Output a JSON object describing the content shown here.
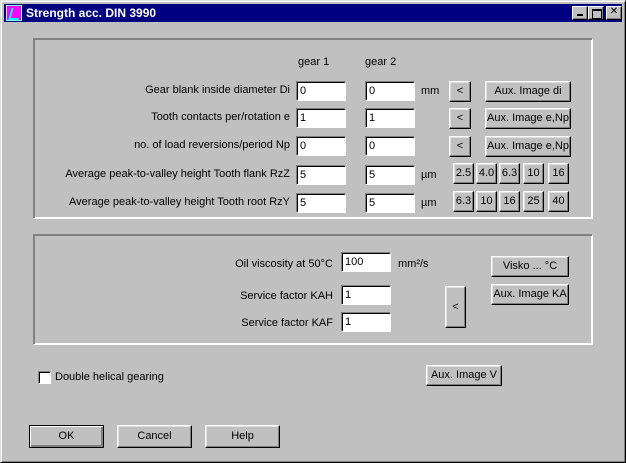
{
  "window": {
    "title": "Strength acc. DIN 3990"
  },
  "gear_table": {
    "col_gear1": "gear 1",
    "col_gear2": "gear 2",
    "rows": [
      {
        "label": "Gear blank inside diameter Di",
        "gear1": "0",
        "gear2": "0",
        "unit": "mm",
        "aux": "Aux. Image di"
      },
      {
        "label": "Tooth contacts per/rotation e",
        "gear1": "1",
        "gear2": "1",
        "unit": "",
        "aux": "Aux. Image e,Np"
      },
      {
        "label": "no. of load reversions/period Np",
        "gear1": "0",
        "gear2": "0",
        "unit": "",
        "aux": "Aux. Image e,Np"
      },
      {
        "label": "Average peak-to-valley height Tooth flank RzZ",
        "gear1": "5",
        "gear2": "5",
        "unit": "µm",
        "presets": [
          "2.5",
          "4.0",
          "6.3",
          "10",
          "16"
        ]
      },
      {
        "label": "Average peak-to-valley height Tooth root RzY",
        "gear1": "5",
        "gear2": "5",
        "unit": "µm",
        "presets": [
          "6.3",
          "10",
          "16",
          "25",
          "40"
        ]
      }
    ],
    "arrow": "<"
  },
  "oil_group": {
    "viscosity_label": "Oil viscosity at 50°C",
    "viscosity_value": "100",
    "viscosity_unit": "mm²/s",
    "kah_label": "Service factor KAH",
    "kah_value": "1",
    "kaf_label": "Service factor KAF",
    "kaf_value": "1",
    "visko_button": "Visko ... °C",
    "aux_ka_button": "Aux. Image KA",
    "arrow": "<"
  },
  "double_helical": {
    "label": "Double helical gearing",
    "checked": false
  },
  "aux_v_button": "Aux. Image V",
  "footer": {
    "ok": "OK",
    "cancel": "Cancel",
    "help": "Help"
  }
}
